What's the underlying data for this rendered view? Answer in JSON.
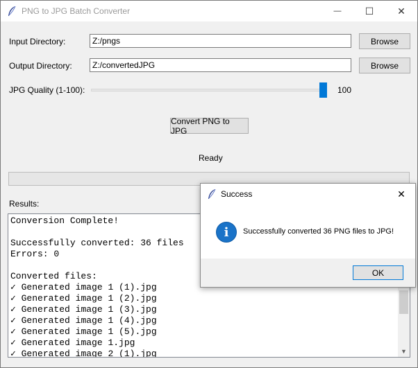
{
  "window": {
    "title": "PNG to JPG Batch Converter",
    "minimize_glyph": "—",
    "maximize_glyph": "☐",
    "close_glyph": "✕"
  },
  "form": {
    "input_label": "Input Directory:",
    "input_value": "Z:/pngs",
    "output_label": "Output Directory:",
    "output_value": "Z:/convertedJPG",
    "browse_label": "Browse",
    "quality_label": "JPG Quality (1-100):",
    "quality_value": "100",
    "quality_level": 100,
    "convert_label": "Convert PNG to JPG",
    "status": "Ready",
    "progress_percent": 0
  },
  "results": {
    "label": "Results:",
    "lines": [
      "Conversion Complete!",
      "",
      "Successfully converted: 36 files",
      "Errors: 0",
      "",
      "Converted files:",
      "✓ Generated image 1 (1).jpg",
      "✓ Generated image 1 (2).jpg",
      "✓ Generated image 1 (3).jpg",
      "✓ Generated image 1 (4).jpg",
      "✓ Generated image 1 (5).jpg",
      "✓ Generated image 1.jpg",
      "✓ Generated image 2 (1).jpg"
    ]
  },
  "dialog": {
    "title": "Success",
    "close_glyph": "✕",
    "icon_glyph": "i",
    "message": "Successfully converted 36 PNG files to JPG!",
    "ok_label": "OK"
  },
  "colors": {
    "accent": "#0078d7",
    "info_icon": "#1a73c8",
    "window_bg": "#f0f0f0"
  }
}
